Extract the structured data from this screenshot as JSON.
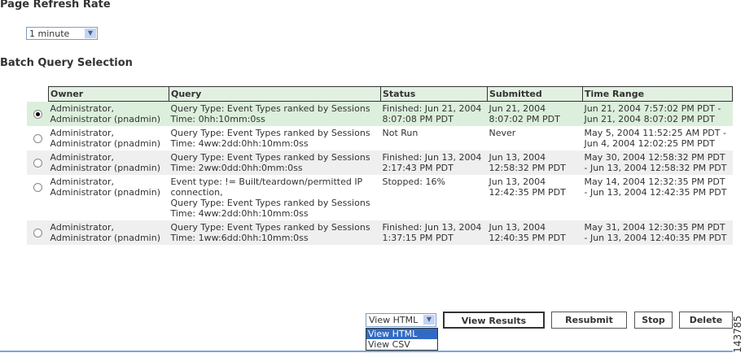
{
  "refresh": {
    "heading": "Page Refresh Rate",
    "value": "1 minute"
  },
  "batch": {
    "heading": "Batch Query Selection",
    "columns": [
      "Owner",
      "Query",
      "Status",
      "Submitted",
      "Time Range"
    ],
    "rows": [
      {
        "owner": "Administrator, Administrator (pnadmin)",
        "query": [
          "Query Type: Event Types ranked by Sessions",
          "Time: 0hh:10mm:0ss"
        ],
        "status": "Finished: Jun 21, 2004 8:07:08 PM PDT",
        "submitted": "Jun 21, 2004 8:07:02 PM PDT",
        "range": "Jun 21, 2004 7:57:02 PM PDT - Jun 21, 2004 8:07:02 PM PDT"
      },
      {
        "owner": "Administrator, Administrator (pnadmin)",
        "query": [
          "Query Type: Event Types ranked by Sessions",
          "Time: 4ww:2dd:0hh:10mm:0ss"
        ],
        "status": "Not Run",
        "submitted": "Never",
        "range": "May 5, 2004 11:52:25 AM PDT - Jun 4, 2004 12:02:25 PM PDT"
      },
      {
        "owner": "Administrator, Administrator (pnadmin)",
        "query": [
          "Query Type: Event Types ranked by Sessions",
          "Time: 2ww:0dd:0hh:0mm:0ss"
        ],
        "status": "Finished: Jun 13, 2004 2:17:43 PM PDT",
        "submitted": "Jun 13, 2004 12:58:32 PM PDT",
        "range": "May 30, 2004 12:58:32 PM PDT - Jun 13, 2004 12:58:32 PM PDT"
      },
      {
        "owner": "Administrator, Administrator (pnadmin)",
        "query": [
          "Event type: != Built/teardown/permitted IP connection,",
          "Query Type: Event Types ranked by Sessions",
          "Time: 4ww:2dd:0hh:10mm:0ss"
        ],
        "status": "Stopped: 16%",
        "submitted": "Jun 13, 2004 12:42:35 PM PDT",
        "range": "May 14, 2004 12:32:35 PM PDT - Jun 13, 2004 12:42:35 PM PDT"
      },
      {
        "owner": "Administrator, Administrator (pnadmin)",
        "query": [
          "Query Type: Event Types ranked by Sessions",
          "Time: 1ww:6dd:0hh:10mm:0ss"
        ],
        "status": "Finished: Jun 13, 2004 1:37:15 PM PDT",
        "submitted": "Jun 13, 2004 12:40:35 PM PDT",
        "range": "May 31, 2004 12:30:35 PM PDT - Jun 13, 2004 12:40:35 PM PDT"
      }
    ]
  },
  "actions": {
    "format": "View HTML",
    "options": [
      "View HTML",
      "View CSV"
    ],
    "view": "View Results",
    "resubmit": "Resubmit",
    "stop": "Stop",
    "delete": "Delete"
  },
  "figure_id": "143785"
}
